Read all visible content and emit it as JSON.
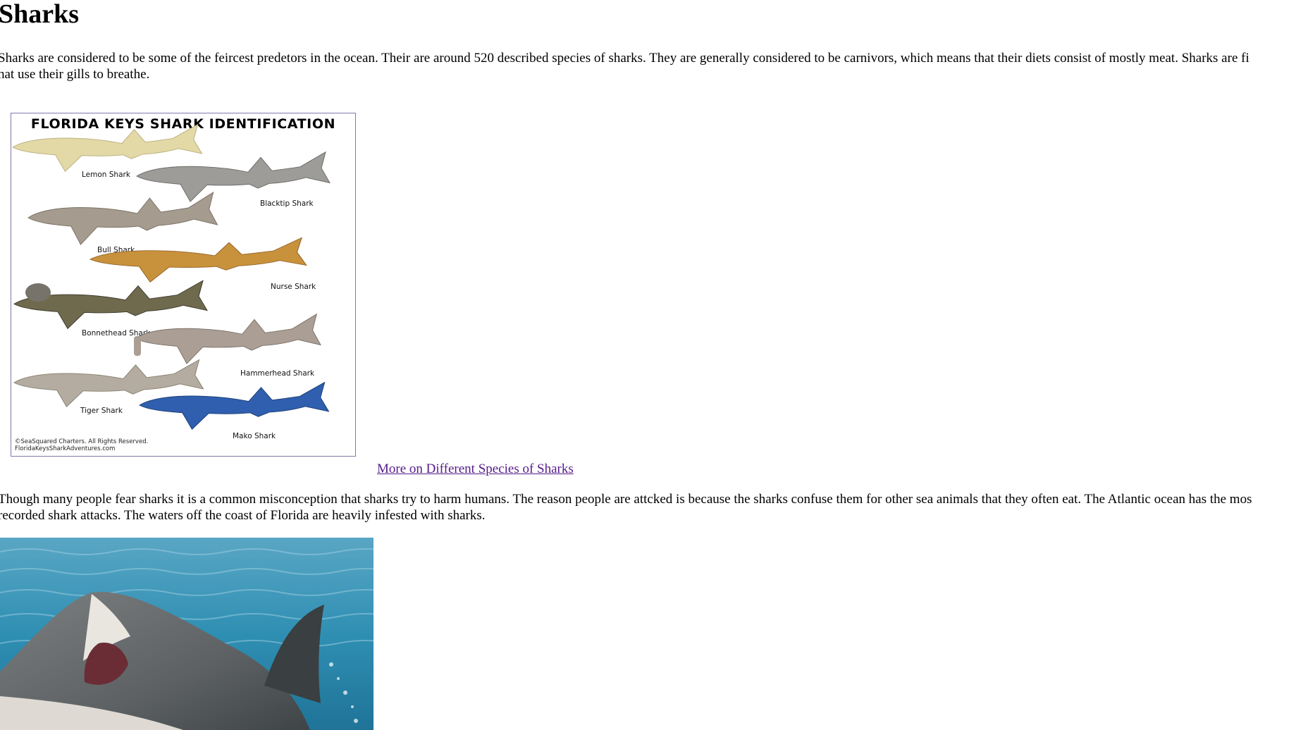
{
  "page": {
    "title": "Sharks",
    "intro": "Sharks are considered to be some of the feircest predetors in the ocean. Their are around 520 described species of sharks. They are generally considered to be carnivors, which means that their diets consist of mostly meat. Sharks are fi\nhat use their gills to breathe.",
    "species_link": "More on Different Species of Sharks",
    "attacks": "Though many people fear sharks it is a common misconception that sharks try to harm humans. The reason people are attcked is because the sharks confuse them for other sea animals that they often eat. The Atlantic ocean has the mos\nrecorded shark attacks. The waters off the coast of Florida are heavily infested with sharks."
  },
  "poster": {
    "title": "FLORIDA KEYS SHARK IDENTIFICATION",
    "labels": {
      "lemon": "Lemon Shark",
      "blacktip": "Blacktip Shark",
      "bull": "Bull Shark",
      "nurse": "Nurse Shark",
      "bonnethead": "Bonnethead Shark",
      "hammerhead": "Hammerhead Shark",
      "tiger": "Tiger Shark",
      "mako": "Mako Shark"
    },
    "credit_line1": "©SeaSquared Charters. All Rights Reserved.",
    "credit_line2": "FloridaKeysSharkAdventures.com"
  },
  "colors": {
    "link_visited": "#551a8b",
    "poster_border": "#7f7aa8",
    "lemon": "#e3d9a6",
    "blacktip": "#9e9c99",
    "bull": "#a59b8e",
    "nurse": "#c8913b",
    "bonnethead": "#6f6a4e",
    "hammerhead": "#ab9f95",
    "tiger": "#b4aca0",
    "mako": "#2f5fae",
    "water": "#2f8fb3"
  }
}
